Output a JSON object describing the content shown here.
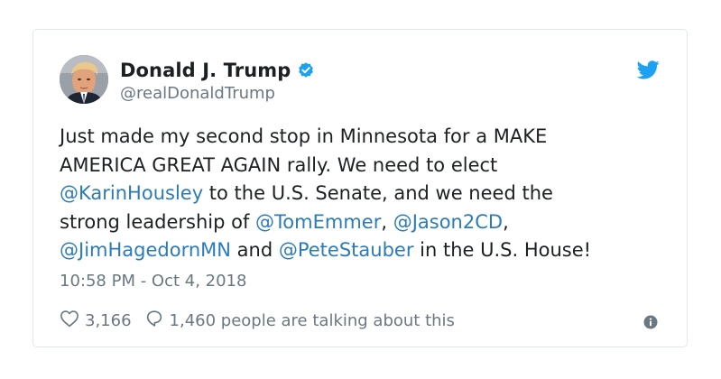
{
  "author": {
    "name": "Donald J. Trump",
    "handle": "@realDonaldTrump",
    "verified_icon": "verified-badge-icon",
    "avatar_icon": "avatar"
  },
  "tweet": {
    "lines": [
      [
        {
          "text": "Just made my second stop in Minnesota for a MAKE",
          "mention": false
        }
      ],
      [
        {
          "text": "AMERICA GREAT AGAIN rally. We need to elect",
          "mention": false
        }
      ],
      [
        {
          "text": "@KarinHousley",
          "mention": true
        },
        {
          "text": " to the U.S. Senate, and we need the",
          "mention": false
        }
      ],
      [
        {
          "text": "strong leadership of ",
          "mention": false
        },
        {
          "text": "@TomEmmer",
          "mention": true
        },
        {
          "text": ", ",
          "mention": false
        },
        {
          "text": "@Jason2CD",
          "mention": true
        },
        {
          "text": ",",
          "mention": false
        }
      ],
      [
        {
          "text": "@JimHagedornMN",
          "mention": true
        },
        {
          "text": " and ",
          "mention": false
        },
        {
          "text": "@PeteStauber",
          "mention": true
        },
        {
          "text": " in the U.S. House!",
          "mention": false
        }
      ]
    ],
    "timestamp": "10:58 PM - Oct 4, 2018"
  },
  "actions": {
    "like_count": "3,166",
    "reply_text": "1,460 people are talking about this",
    "like_icon": "heart-icon",
    "reply_icon": "speech-bubble-icon",
    "info_icon": "info-icon"
  },
  "colors": {
    "mention": "#2b7bb9",
    "verified": "#1da1f2",
    "twitter_brand": "#1da1f2",
    "muted_text": "#697882",
    "body_text": "#1c2022",
    "border": "#e1e8ed"
  }
}
